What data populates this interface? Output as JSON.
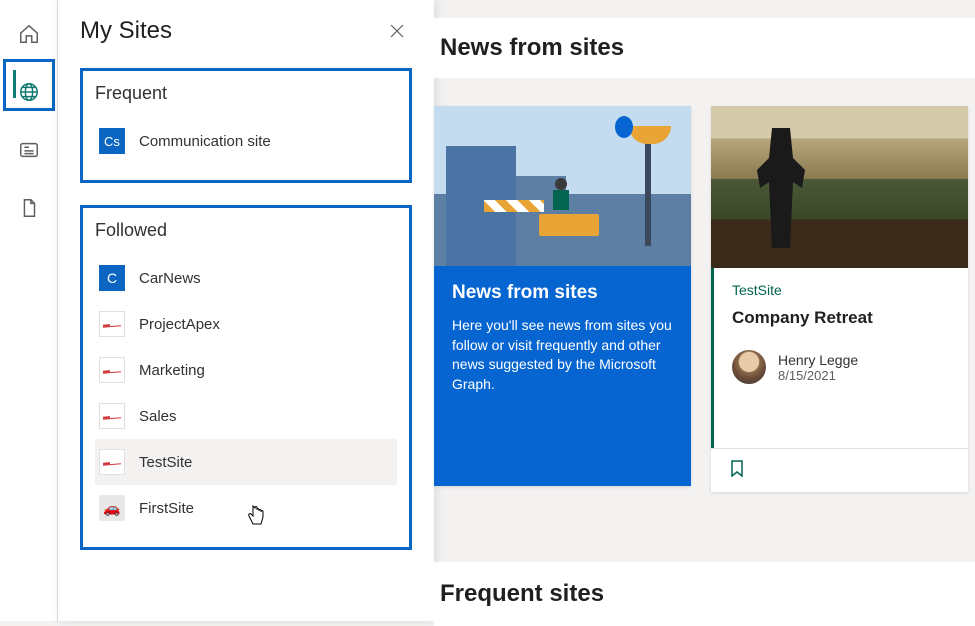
{
  "panel": {
    "title": "My Sites",
    "frequent": {
      "heading": "Frequent",
      "items": [
        {
          "icon_text": "Cs",
          "label": "Communication site"
        }
      ]
    },
    "followed": {
      "heading": "Followed",
      "items": [
        {
          "icon_text": "C",
          "label": "CarNews"
        },
        {
          "label": "ProjectApex"
        },
        {
          "label": "Marketing"
        },
        {
          "label": "Sales"
        },
        {
          "label": "TestSite"
        },
        {
          "label": "FirstSite"
        }
      ]
    }
  },
  "main": {
    "news_header": "News from sites",
    "frequent_header": "Frequent sites",
    "promo_card": {
      "title": "News from sites",
      "body": "Here you'll see news from sites you follow or visit frequently and other news suggested by the Microsoft Graph."
    },
    "site_card": {
      "site_name": "TestSite",
      "title": "Company Retreat",
      "author": "Henry Legge",
      "date": "8/15/2021"
    }
  }
}
